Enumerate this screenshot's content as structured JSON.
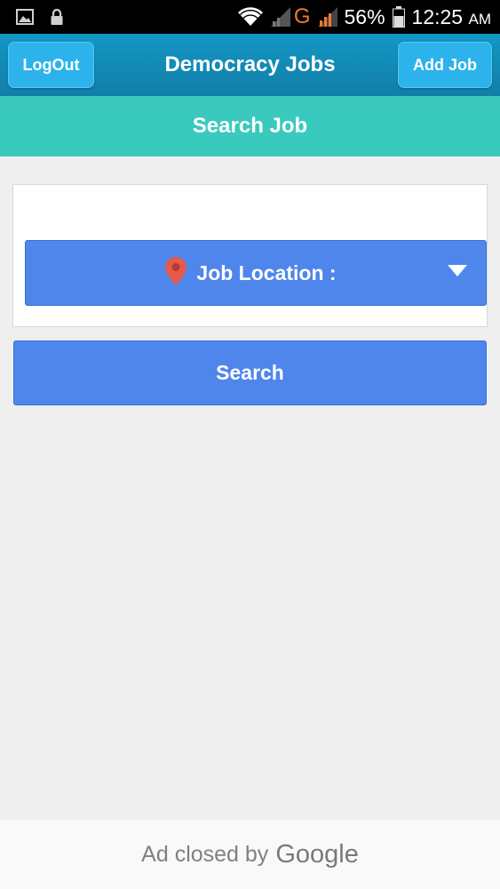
{
  "status_bar": {
    "carrier": "G",
    "battery_percent": "56%",
    "time": "12:25",
    "time_suffix": "AM",
    "icons": [
      "image-icon",
      "lock-icon",
      "wifi-icon",
      "signal-icon",
      "signal-icon",
      "battery-icon"
    ]
  },
  "header": {
    "logout_label": "LogOut",
    "title": "Democracy Jobs",
    "add_job_label": "Add Job"
  },
  "sub_header": {
    "title": "Search Job"
  },
  "search_form": {
    "location_label": "Job Location :",
    "search_label": "Search"
  },
  "ad": {
    "text": "Ad closed by",
    "brand": "Google"
  },
  "colors": {
    "header_bg": "#1497c4",
    "sub_header_bg": "#3ac9bd",
    "button_blue": "#4f86ec",
    "header_button": "#2cb3ec",
    "pin_red": "#e35a4e"
  }
}
